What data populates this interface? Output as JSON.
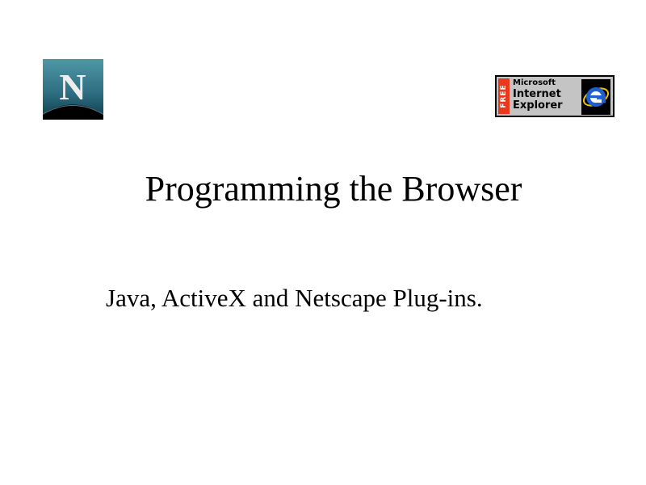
{
  "slide": {
    "title": "Programming the Browser",
    "subtitle": "Java, ActiveX and Netscape Plug-ins."
  },
  "netscape_logo": {
    "letter": "N",
    "icon": "netscape-n-logo",
    "colors": {
      "sky_top": "#4a8c9c",
      "sky_bottom": "#0d3b4d",
      "horizon": "#000000",
      "letter": "#e8e8e8"
    }
  },
  "ie_badge": {
    "free_label": "FREE",
    "line1": "Microsoft",
    "line2": "Internet",
    "line3": "Explorer",
    "icon": "internet-explorer-e-logo",
    "colors": {
      "free_bg": "#e8391c",
      "badge_bg": "#c4c4c4",
      "e_blue": "#1f5fcf"
    }
  }
}
